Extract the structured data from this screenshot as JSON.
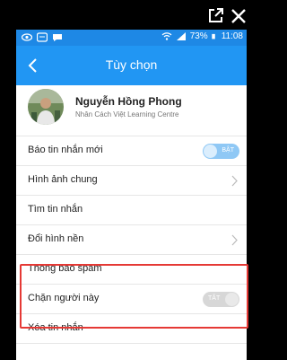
{
  "statusbar": {
    "battery": "73%",
    "time": "11:08"
  },
  "appbar": {
    "title": "Tùy chọn"
  },
  "profile": {
    "name": "Nguyễn Hồng Phong",
    "subtitle": "Nhân Cách Việt Learning Centre"
  },
  "settings": [
    {
      "label": "Báo tin nhắn mới",
      "control": "toggle",
      "state": "on",
      "toggle_text": "BẬT"
    },
    {
      "label": "Hình ảnh chung",
      "control": "chevron"
    },
    {
      "label": "Tìm tin nhắn",
      "control": "none"
    },
    {
      "label": "Đổi hình nền",
      "control": "chevron"
    },
    {
      "label": "Thông báo spam",
      "control": "none"
    },
    {
      "label": "Chặn người này",
      "control": "toggle",
      "state": "off",
      "toggle_text": "TẮT"
    },
    {
      "label": "Xóa tin nhắn",
      "control": "none"
    }
  ],
  "colors": {
    "appbar": "#2196f3",
    "statusbar": "#1e88e5",
    "highlight": "#e53935"
  }
}
